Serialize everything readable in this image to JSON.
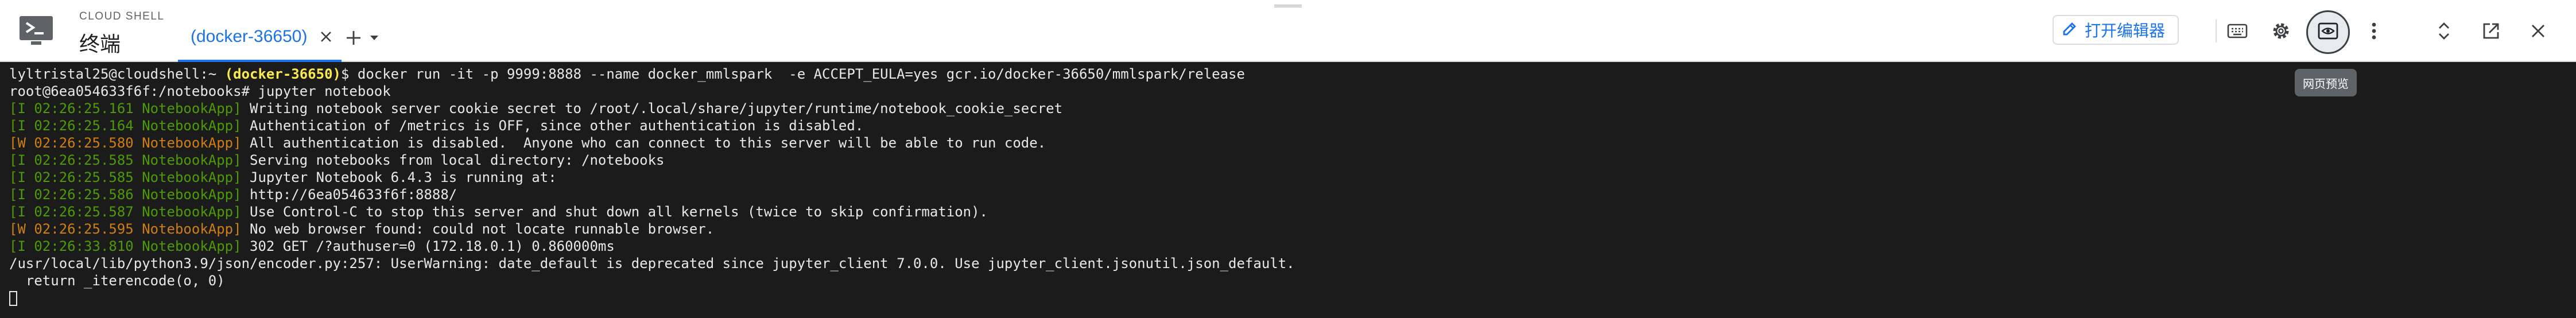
{
  "header": {
    "product_name": "CLOUD SHELL",
    "title": "终端",
    "tab_label": "(docker-36650)",
    "open_editor_label": "打开编辑器",
    "preview_tooltip": "网页预览",
    "accent_color": "#1a73e8",
    "icons": [
      "terminal-app-icon",
      "close-icon",
      "add-icon",
      "chevron-down-icon",
      "pencil-icon",
      "keyboard-icon",
      "gear-icon",
      "web-preview-icon",
      "more-vert-icon",
      "expand-icon",
      "open-new-window-icon",
      "close-icon"
    ]
  },
  "terminal": {
    "lines": [
      {
        "segments": [
          {
            "text": "lyltristal25@cloudshell:~ ",
            "style": ""
          },
          {
            "text": "(docker-36650)",
            "style": "bold"
          },
          {
            "text": "$ docker run -it -p 9999:8888 --name docker_mmlspark  -e ACCEPT_EULA=yes gcr.io/docker-36650/mmlspark/release",
            "style": ""
          }
        ]
      },
      {
        "segments": [
          {
            "text": "root@6ea054633f6f:/notebooks# jupyter notebook",
            "style": ""
          }
        ]
      },
      {
        "segments": [
          {
            "text": "[I 02:26:25.161 NotebookApp]",
            "style": "green"
          },
          {
            "text": " Writing notebook server cookie secret to /root/.local/share/jupyter/runtime/notebook_cookie_secret",
            "style": ""
          }
        ]
      },
      {
        "segments": [
          {
            "text": "[I 02:26:25.164 NotebookApp]",
            "style": "green"
          },
          {
            "text": " Authentication of /metrics is OFF, since other authentication is disabled.",
            "style": ""
          }
        ]
      },
      {
        "segments": [
          {
            "text": "[W 02:26:25.580 NotebookApp]",
            "style": "orange"
          },
          {
            "text": " All authentication is disabled.  Anyone who can connect to this server will be able to run code.",
            "style": ""
          }
        ]
      },
      {
        "segments": [
          {
            "text": "[I 02:26:25.585 NotebookApp]",
            "style": "green"
          },
          {
            "text": " Serving notebooks from local directory: /notebooks",
            "style": ""
          }
        ]
      },
      {
        "segments": [
          {
            "text": "[I 02:26:25.585 NotebookApp]",
            "style": "green"
          },
          {
            "text": " Jupyter Notebook 6.4.3 is running at:",
            "style": ""
          }
        ]
      },
      {
        "segments": [
          {
            "text": "[I 02:26:25.586 NotebookApp]",
            "style": "green"
          },
          {
            "text": " http://6ea054633f6f:8888/",
            "style": ""
          }
        ]
      },
      {
        "segments": [
          {
            "text": "[I 02:26:25.587 NotebookApp]",
            "style": "green"
          },
          {
            "text": " Use Control-C to stop this server and shut down all kernels (twice to skip confirmation).",
            "style": ""
          }
        ]
      },
      {
        "segments": [
          {
            "text": "[W 02:26:25.595 NotebookApp]",
            "style": "orange"
          },
          {
            "text": " No web browser found: could not locate runnable browser.",
            "style": ""
          }
        ]
      },
      {
        "segments": [
          {
            "text": "[I 02:26:33.810 NotebookApp]",
            "style": "green"
          },
          {
            "text": " 302 GET /?authuser=0 (172.18.0.1) 0.860000ms",
            "style": ""
          }
        ]
      },
      {
        "segments": [
          {
            "text": "/usr/local/lib/python3.9/json/encoder.py:257: UserWarning: date_default is deprecated since jupyter_client 7.0.0. Use jupyter_client.jsonutil.json_default.",
            "style": ""
          }
        ]
      },
      {
        "segments": [
          {
            "text": "  return _iterencode(o, 0)",
            "style": ""
          }
        ]
      }
    ]
  }
}
